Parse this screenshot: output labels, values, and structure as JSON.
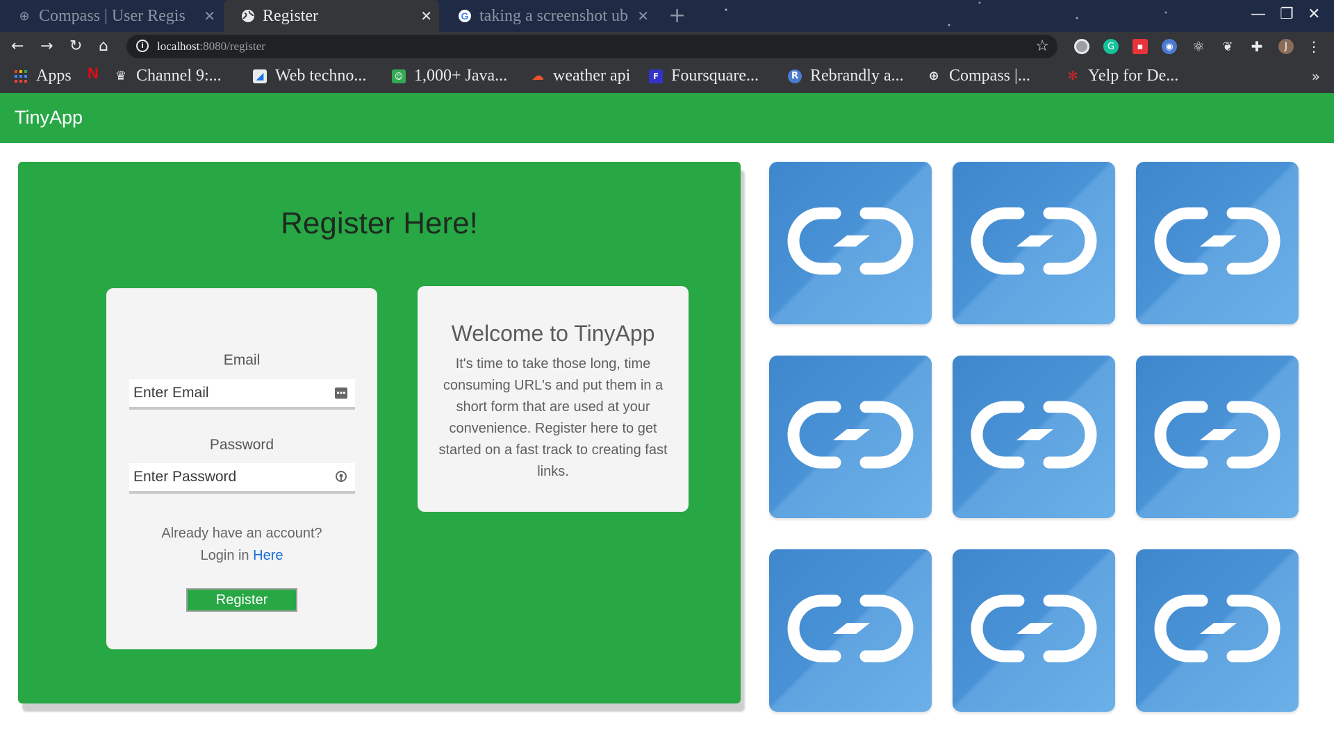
{
  "browser": {
    "tabs": [
      {
        "title": "Compass | User Regis",
        "active": false,
        "icon": "compass-icon"
      },
      {
        "title": "Register",
        "active": true,
        "icon": "globe-icon"
      },
      {
        "title": "taking a screenshot ub",
        "active": false,
        "icon": "google-icon"
      }
    ],
    "url_host": "localhost",
    "url_path": ":8080/register",
    "bookmarks": [
      {
        "label": "Apps",
        "icon": "apps-grid-icon"
      },
      {
        "label": "",
        "icon": "netflix-icon"
      },
      {
        "label": "Channel 9:...",
        "icon": "channel9-icon"
      },
      {
        "label": "Web techno...",
        "icon": "web-technology-icon"
      },
      {
        "label": "1,000+ Java...",
        "icon": "java-icon"
      },
      {
        "label": "weather api",
        "icon": "weather-icon"
      },
      {
        "label": "Foursquare...",
        "icon": "foursquare-icon"
      },
      {
        "label": "Rebrandly a...",
        "icon": "rebrandly-icon"
      },
      {
        "label": "Compass |...",
        "icon": "compass-icon"
      },
      {
        "label": "Yelp for De...",
        "icon": "yelp-icon"
      }
    ],
    "profile_initial": "J"
  },
  "app": {
    "brand": "TinyApp"
  },
  "register": {
    "title": "Register Here!",
    "email_label": "Email",
    "email_placeholder": "Enter Email",
    "password_label": "Password",
    "password_placeholder": "Enter Password",
    "account_prompt": "Already have an account?",
    "login_prefix": "Login in",
    "login_link": "Here",
    "submit_label": "Register"
  },
  "welcome": {
    "title": "Welcome to TinyApp",
    "body": "It's time to take those long, time consuming URL's and put them in a short form that are used at your convenience. Register here to get started on a fast track to creating fast links."
  },
  "tiles": {
    "count": 9,
    "icon": "link-icon"
  },
  "colors": {
    "brand_green": "#28a745",
    "tile_blue": "#4a92d6",
    "link_blue": "#1a6ed8"
  }
}
